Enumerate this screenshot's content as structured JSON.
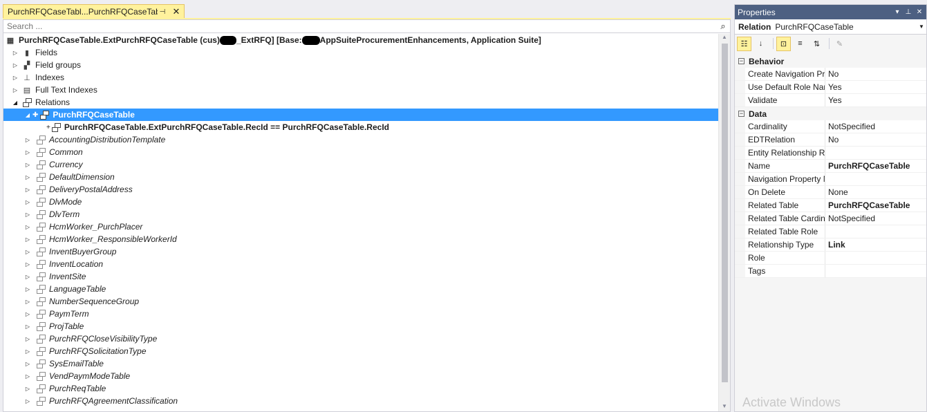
{
  "tab": {
    "title": "PurchRFQCaseTabl...PurchRFQCaseTable",
    "pin_icon": "pin-icon",
    "close_icon": "close-icon"
  },
  "search": {
    "placeholder": "Search ..."
  },
  "tree": {
    "root_prefix": "PurchRFQCaseTable.ExtPurchRFQCaseTable (cus) ",
    "root_mid": "_ExtRFQ] [Base: ",
    "root_suffix": "AppSuiteProcurementEnhancements, Application Suite]",
    "nodes": {
      "fields": "Fields",
      "field_groups": "Field groups",
      "indexes": "Indexes",
      "full_text_indexes": "Full Text Indexes",
      "relations": "Relations",
      "selected_relation": "PurchRFQCaseTable",
      "constraint": "PurchRFQCaseTable.ExtPurchRFQCaseTable.RecId == PurchRFQCaseTable.RecId"
    },
    "inherited_relations": [
      "AccountingDistributionTemplate",
      "Common",
      "Currency",
      "DefaultDimension",
      "DeliveryPostalAddress",
      "DlvMode",
      "DlvTerm",
      "HcmWorker_PurchPlacer",
      "HcmWorker_ResponsibleWorkerId",
      "InventBuyerGroup",
      "InventLocation",
      "InventSite",
      "LanguageTable",
      "NumberSequenceGroup",
      "PaymTerm",
      "ProjTable",
      "PurchRFQCloseVisibilityType",
      "PurchRFQSolicitationType",
      "SysEmailTable",
      "VendPaymModeTable",
      "PurchReqTable",
      "PurchRFQAgreementClassification"
    ]
  },
  "props": {
    "title": "Properties",
    "object_kind": "Relation",
    "object_name": "PurchRFQCaseTable",
    "categories": [
      {
        "name": "Behavior",
        "props": [
          {
            "n": "Create Navigation Pr",
            "v": "No",
            "bold": false
          },
          {
            "n": "Use Default Role Nam",
            "v": "Yes",
            "bold": false
          },
          {
            "n": "Validate",
            "v": "Yes",
            "bold": false
          }
        ]
      },
      {
        "name": "Data",
        "props": [
          {
            "n": "Cardinality",
            "v": "NotSpecified",
            "bold": false
          },
          {
            "n": "EDTRelation",
            "v": "No",
            "bold": false
          },
          {
            "n": "Entity Relationship Ro",
            "v": "",
            "bold": false
          },
          {
            "n": "Name",
            "v": "PurchRFQCaseTable",
            "bold": true
          },
          {
            "n": "Navigation Property M",
            "v": "",
            "bold": false
          },
          {
            "n": "On Delete",
            "v": "None",
            "bold": false
          },
          {
            "n": "Related Table",
            "v": "PurchRFQCaseTable",
            "bold": true
          },
          {
            "n": "Related Table Cardina",
            "v": "NotSpecified",
            "bold": false
          },
          {
            "n": "Related Table Role",
            "v": "",
            "bold": false
          },
          {
            "n": "Relationship Type",
            "v": "Link",
            "bold": true
          },
          {
            "n": "Role",
            "v": "",
            "bold": false
          },
          {
            "n": "Tags",
            "v": "",
            "bold": false
          }
        ]
      }
    ]
  },
  "watermark": "Activate Windows"
}
